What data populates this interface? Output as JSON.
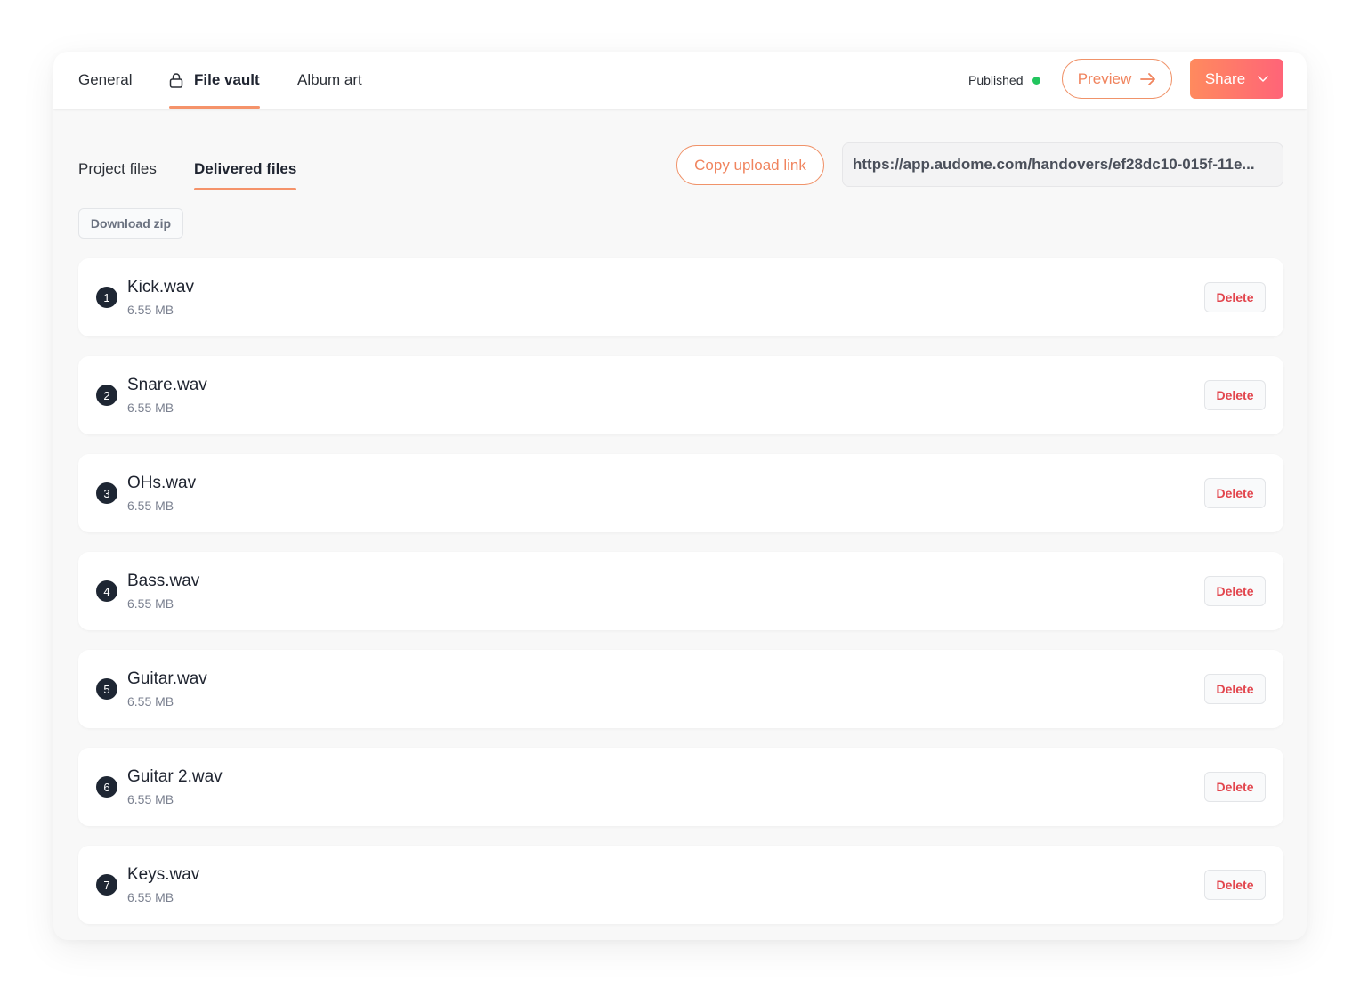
{
  "tabs": [
    {
      "label": "General",
      "active": false,
      "icon": null
    },
    {
      "label": "File vault",
      "active": true,
      "icon": "lock-icon"
    },
    {
      "label": "Album art",
      "active": false,
      "icon": null
    }
  ],
  "status": {
    "label": "Published",
    "color": "#22c55e"
  },
  "actions": {
    "preview_label": "Preview",
    "share_label": "Share"
  },
  "subtabs": [
    {
      "label": "Project files",
      "active": false
    },
    {
      "label": "Delivered files",
      "active": true
    }
  ],
  "upload": {
    "copy_label": "Copy upload link",
    "url": "https://app.audome.com/handovers/ef28dc10-015f-11e..."
  },
  "download_zip_label": "Download zip",
  "files": [
    {
      "index": "1",
      "name": "Kick.wav",
      "size": "6.55 MB"
    },
    {
      "index": "2",
      "name": "Snare.wav",
      "size": "6.55 MB"
    },
    {
      "index": "3",
      "name": "OHs.wav",
      "size": "6.55 MB"
    },
    {
      "index": "4",
      "name": "Bass.wav",
      "size": "6.55 MB"
    },
    {
      "index": "5",
      "name": "Guitar.wav",
      "size": "6.55 MB"
    },
    {
      "index": "6",
      "name": "Guitar 2.wav",
      "size": "6.55 MB"
    },
    {
      "index": "7",
      "name": "Keys.wav",
      "size": "6.55 MB"
    }
  ],
  "delete_label": "Delete",
  "colors": {
    "accent": "#f5936a",
    "share_gradient_start": "#ff8a5e",
    "share_gradient_end": "#ff6478",
    "delete": "#e2464e",
    "badge": "#1e2633"
  }
}
